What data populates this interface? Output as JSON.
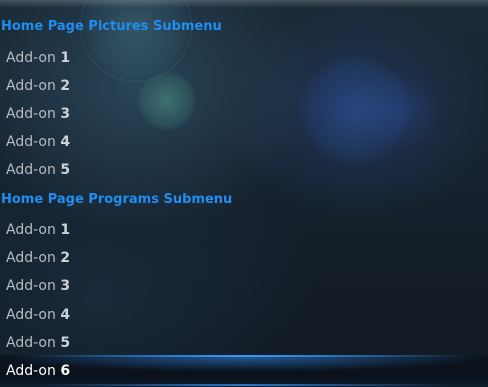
{
  "menu": {
    "pictures_header": "Home Page Pictures Submenu",
    "pictures_items": [
      {
        "prefix": "Add-on",
        "number": "1"
      },
      {
        "prefix": "Add-on",
        "number": "2"
      },
      {
        "prefix": "Add-on",
        "number": "3"
      },
      {
        "prefix": "Add-on",
        "number": "4"
      },
      {
        "prefix": "Add-on",
        "number": "5"
      }
    ],
    "programs_header": "Home Page Programs Submenu",
    "programs_items": [
      {
        "prefix": "Add-on",
        "number": "1"
      },
      {
        "prefix": "Add-on",
        "number": "2"
      },
      {
        "prefix": "Add-on",
        "number": "3"
      },
      {
        "prefix": "Add-on",
        "number": "4"
      },
      {
        "prefix": "Add-on",
        "number": "5"
      },
      {
        "prefix": "Add-on",
        "number": "6"
      }
    ],
    "focused_item": "programs_items.5"
  },
  "colors": {
    "header": "#1e8ef0",
    "item_text": "#b7bcc2",
    "focus_glow": "#3c9cff"
  }
}
